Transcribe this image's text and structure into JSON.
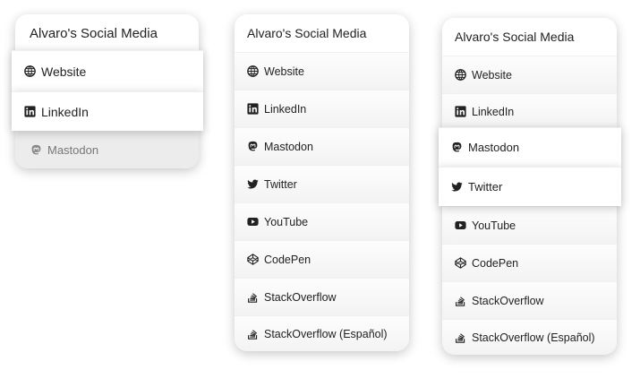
{
  "cards": [
    {
      "title": "Alvaro's Social Media",
      "items": [
        {
          "label": "Website",
          "icon": "globe-icon"
        },
        {
          "label": "LinkedIn",
          "icon": "linkedin-icon"
        },
        {
          "label": "Mastodon",
          "icon": "mastodon-icon"
        }
      ]
    },
    {
      "title": "Alvaro's Social Media",
      "items": [
        {
          "label": "Website",
          "icon": "globe-icon"
        },
        {
          "label": "LinkedIn",
          "icon": "linkedin-icon"
        },
        {
          "label": "Mastodon",
          "icon": "mastodon-icon"
        },
        {
          "label": "Twitter",
          "icon": "twitter-icon"
        },
        {
          "label": "YouTube",
          "icon": "youtube-icon"
        },
        {
          "label": "CodePen",
          "icon": "codepen-icon"
        },
        {
          "label": "StackOverflow",
          "icon": "stackoverflow-icon"
        },
        {
          "label": "StackOverflow (Español)",
          "icon": "stackoverflow-icon"
        }
      ]
    },
    {
      "title": "Alvaro's Social Media",
      "items": [
        {
          "label": "Website",
          "icon": "globe-icon"
        },
        {
          "label": "LinkedIn",
          "icon": "linkedin-icon"
        },
        {
          "label": "Mastodon",
          "icon": "mastodon-icon"
        },
        {
          "label": "Twitter",
          "icon": "twitter-icon"
        },
        {
          "label": "YouTube",
          "icon": "youtube-icon"
        },
        {
          "label": "CodePen",
          "icon": "codepen-icon"
        },
        {
          "label": "StackOverflow",
          "icon": "stackoverflow-icon"
        },
        {
          "label": "StackOverflow (Español)",
          "icon": "stackoverflow-icon"
        }
      ]
    }
  ]
}
